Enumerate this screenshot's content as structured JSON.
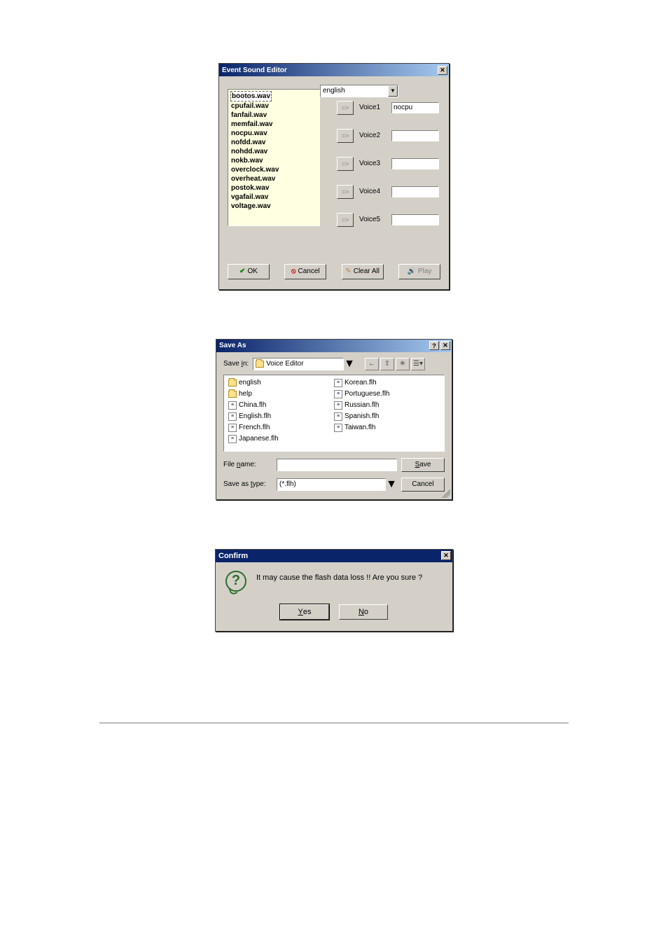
{
  "event_editor": {
    "title": "Event Sound Editor",
    "close_glyph": "✕",
    "language": "english",
    "files": [
      "bootos.wav",
      "cpufail.wav",
      "fanfail.wav",
      "memfail.wav",
      "nocpu.wav",
      "nofdd.wav",
      "nohdd.wav",
      "nokb.wav",
      "overclock.wav",
      "overheat.wav",
      "postok.wav",
      "vgafail.wav",
      "voltage.wav"
    ],
    "selected_file_index": 0,
    "assign_glyph": "=>",
    "voices": [
      {
        "label": "Voice1",
        "value": "nocpu"
      },
      {
        "label": "Voice2",
        "value": ""
      },
      {
        "label": "Voice3",
        "value": ""
      },
      {
        "label": "Voice4",
        "value": ""
      },
      {
        "label": "Voice5",
        "value": ""
      }
    ],
    "buttons": {
      "ok": "OK",
      "cancel": "Cancel",
      "clear_all": "Clear All",
      "play": "Play"
    }
  },
  "save_as": {
    "title": "Save As",
    "help_glyph": "?",
    "close_glyph": "✕",
    "save_in_label": "Save in:",
    "folder": "Voice Editor",
    "nav_icon_names": [
      "back-icon",
      "up-one-level-icon",
      "new-folder-icon",
      "view-menu-icon"
    ],
    "files_col1": [
      {
        "name": "english",
        "type": "folder"
      },
      {
        "name": "help",
        "type": "folder"
      },
      {
        "name": "China.flh",
        "type": "file"
      },
      {
        "name": "English.flh",
        "type": "file"
      },
      {
        "name": "French.flh",
        "type": "file"
      },
      {
        "name": "Japanese.flh",
        "type": "file"
      }
    ],
    "files_col2": [
      {
        "name": "Korean.flh",
        "type": "file"
      },
      {
        "name": "Portuguese.flh",
        "type": "file"
      },
      {
        "name": "Russian.flh",
        "type": "file"
      },
      {
        "name": "Spanish.flh",
        "type": "file"
      },
      {
        "name": "Taiwan.flh",
        "type": "file"
      }
    ],
    "file_name_label": "File name:",
    "file_name_value": "",
    "save_as_type_label": "Save as type:",
    "save_as_type_value": "(*.flh)",
    "save_button": "Save",
    "cancel_button": "Cancel"
  },
  "confirm": {
    "title": "Confirm",
    "close_glyph": "✕",
    "message": "It may cause the flash data loss !!  Are you sure ?",
    "yes": "Yes",
    "no": "No"
  }
}
